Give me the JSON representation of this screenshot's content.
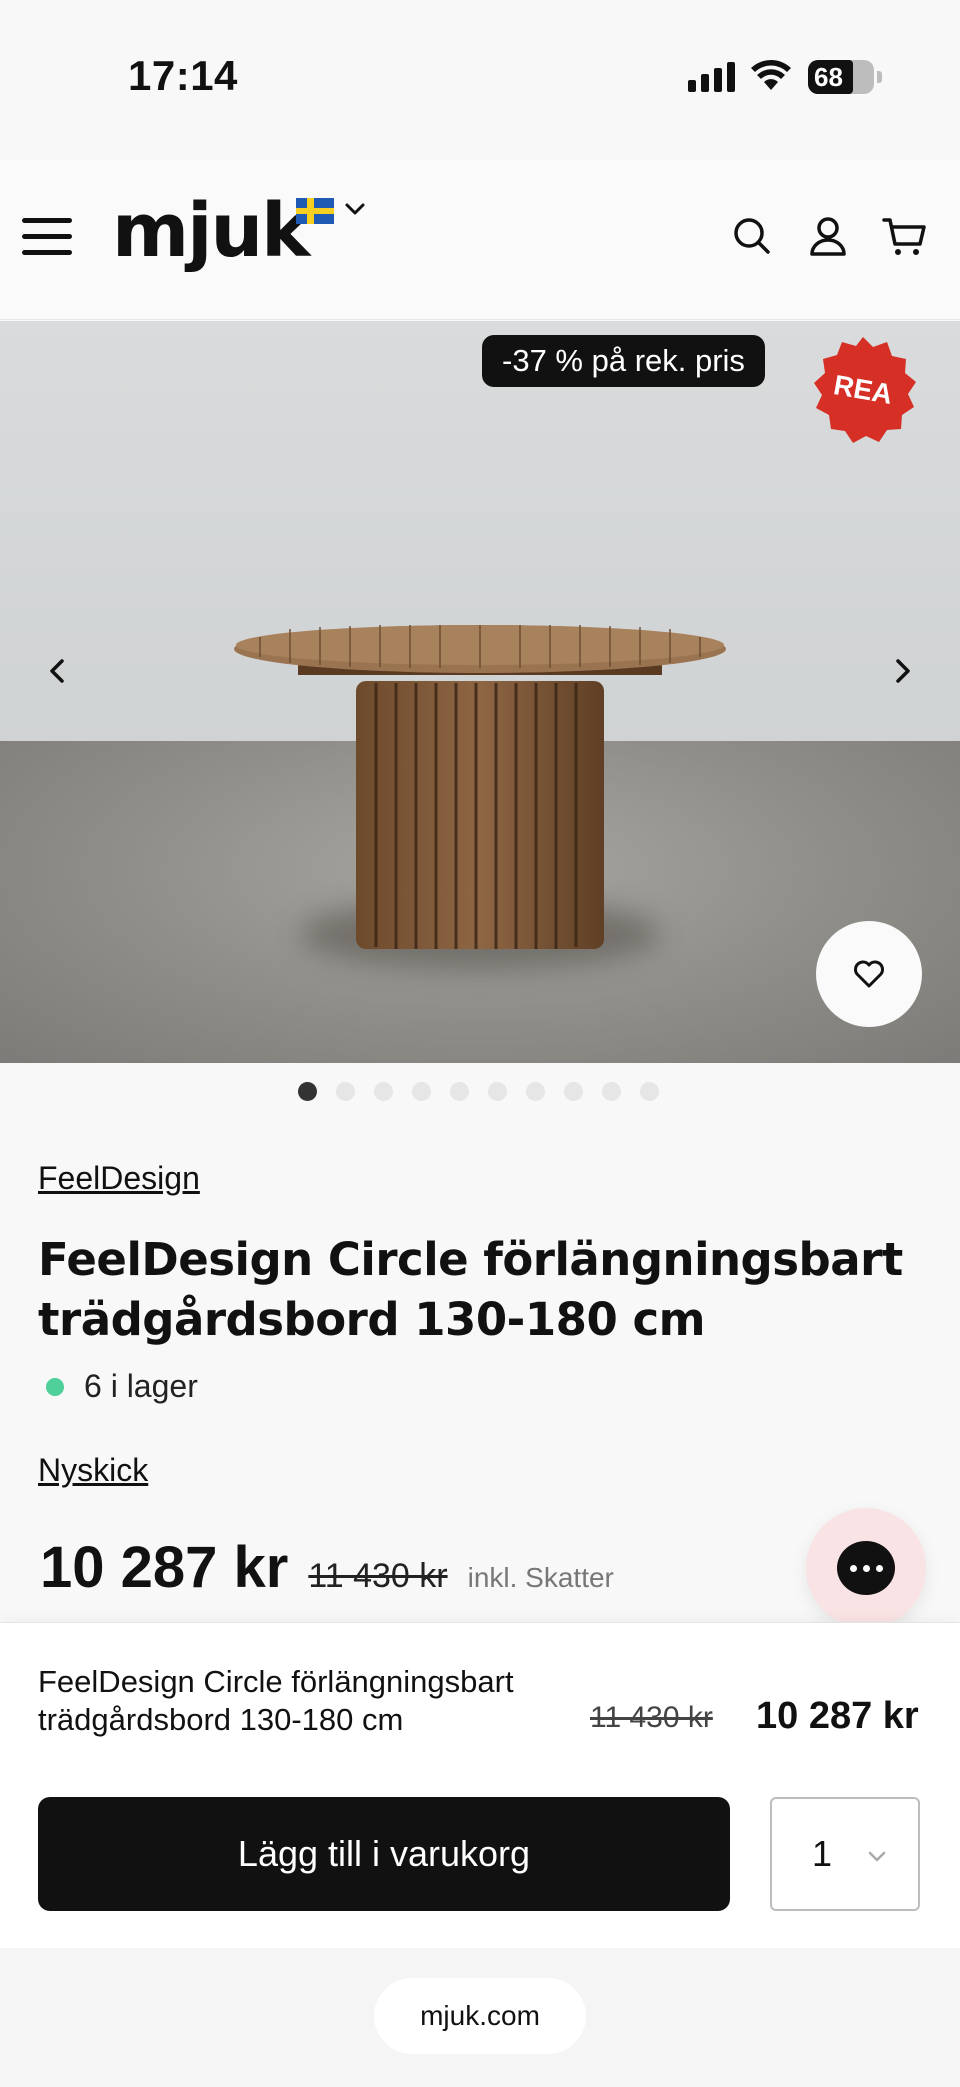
{
  "status_bar": {
    "time": "17:14",
    "battery": "68"
  },
  "header": {
    "logo": "mjuk"
  },
  "product_image": {
    "discount_tag": "-37 % på rek. pris",
    "sale_badge": "REA",
    "slide_count": 10,
    "active_slide": 1
  },
  "product": {
    "brand": "FeelDesign",
    "title": "FeelDesign Circle förlängningsbart trädgårdsbord 130-180 cm",
    "stock": "6 i lager",
    "condition": "Nyskick",
    "price_now": "10 287 kr",
    "price_was": "11 430 kr",
    "tax_note": "inkl. Skatter"
  },
  "sticky_bar": {
    "title": "FeelDesign Circle förlängningsbart trädgårdsbord 130-180 cm",
    "price_was": "11 430 kr",
    "price_now": "10 287 kr",
    "add_to_cart": "Lägg till i varukorg",
    "quantity": "1"
  },
  "browser": {
    "url": "mjuk.com"
  },
  "colors": {
    "accent": "#111111",
    "sale_badge": "#d62f26",
    "stock_dot": "#4fcf9a",
    "chat_bg": "#f9e3e4"
  }
}
